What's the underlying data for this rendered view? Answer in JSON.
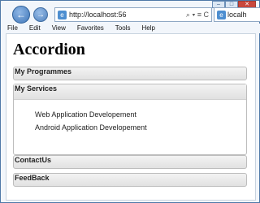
{
  "browser": {
    "address_url": "http://localhost:56",
    "address_icons": "⌕ ▾ ≡ C",
    "tab_title": "localh",
    "menu": [
      "File",
      "Edit",
      "View",
      "Favorites",
      "Tools",
      "Help"
    ],
    "window_controls": {
      "minimize": "–",
      "maximize": "□",
      "close": "✕"
    },
    "nav": {
      "back_icon": "arrow-left-icon",
      "forward_icon": "arrow-right-icon"
    }
  },
  "page": {
    "title": "Accordion",
    "sections": [
      {
        "label": "My Programmes",
        "expanded": false
      },
      {
        "label": "My Services",
        "expanded": true,
        "items": [
          "Web Application Developement",
          "Android Application Developement"
        ]
      },
      {
        "label": "ContactUs",
        "expanded": false
      },
      {
        "label": "FeedBack",
        "expanded": false
      }
    ]
  }
}
